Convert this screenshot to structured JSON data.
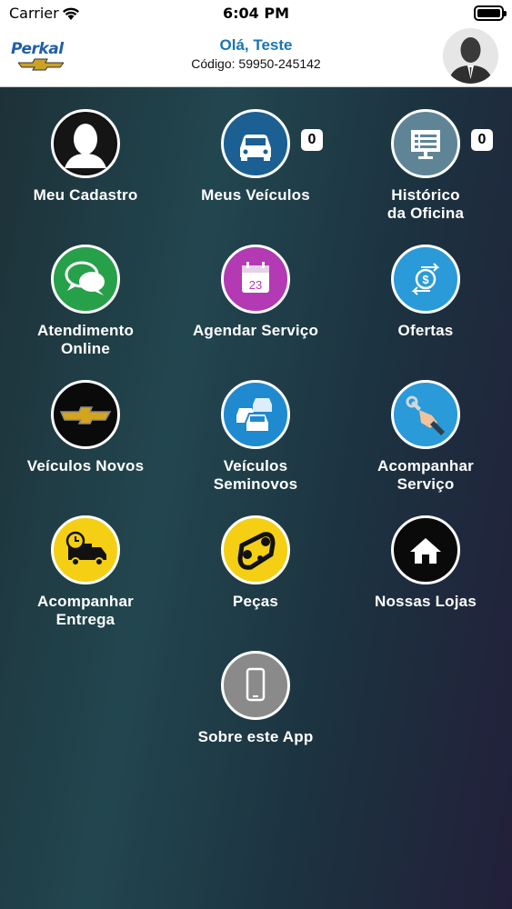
{
  "status_bar": {
    "carrier": "Carrier",
    "time": "6:04 PM"
  },
  "header": {
    "logo_text": "Perkal",
    "greeting": "Olá, Teste",
    "code": "Código: 59950-245142"
  },
  "colors": {
    "accent_blue": "#1a75b5",
    "green": "#27a04a",
    "purple": "#b33ab3",
    "sky": "#2a9ad8",
    "yellow": "#f4cf14",
    "dark": "#111111",
    "gray": "#888888"
  },
  "menu": {
    "meu_cadastro": {
      "label": "Meu Cadastro",
      "icon": "person-icon"
    },
    "meus_veiculos": {
      "label": "Meus Veículos",
      "icon": "car-icon",
      "badge": "0"
    },
    "historico": {
      "label1": "Histórico",
      "label2": "da Oficina",
      "icon": "list-board-icon",
      "badge": "0"
    },
    "atendimento": {
      "label1": "Atendimento",
      "label2": "Online",
      "icon": "chat-icon"
    },
    "agendar": {
      "label": "Agendar Serviço",
      "icon": "calendar-icon",
      "calendar_day": "23"
    },
    "ofertas": {
      "label": "Ofertas",
      "icon": "money-exchange-icon"
    },
    "veiculos_novos": {
      "label": "Veículos Novos",
      "icon": "chevrolet-bowtie-icon"
    },
    "seminovos": {
      "label1": "Veículos",
      "label2": "Seminovos",
      "icon": "cars-icon"
    },
    "acompanhar_servico": {
      "label1": "Acompanhar",
      "label2": "Serviço",
      "icon": "wrench-hand-icon"
    },
    "acompanhar_entrega": {
      "label1": "Acompanhar",
      "label2": "Entrega",
      "icon": "delivery-truck-icon"
    },
    "pecas": {
      "label": "Peças",
      "icon": "belt-pulley-icon"
    },
    "nossas_lojas": {
      "label": "Nossas Lojas",
      "icon": "house-icon"
    },
    "sobre": {
      "label": "Sobre este App",
      "icon": "phone-icon"
    }
  }
}
